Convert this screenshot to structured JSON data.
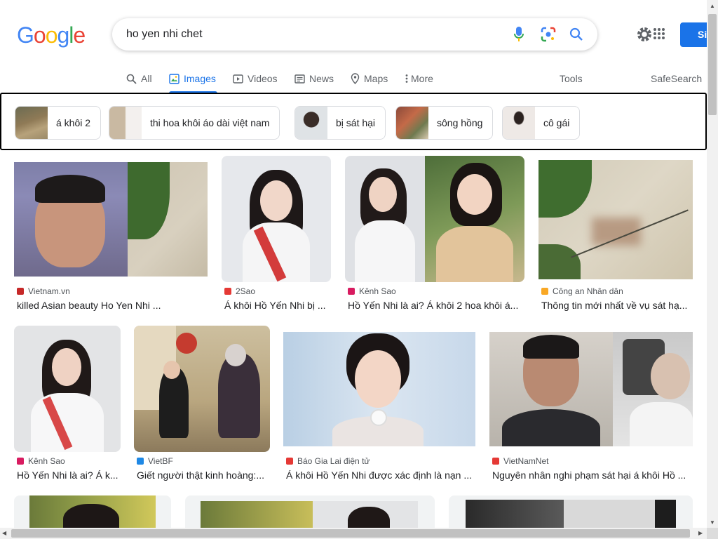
{
  "logo": {
    "letters": [
      "G",
      "o",
      "o",
      "g",
      "l",
      "e"
    ],
    "colors": [
      "#4285F4",
      "#EA4335",
      "#FBBC05",
      "#4285F4",
      "#34A853",
      "#EA4335"
    ]
  },
  "search": {
    "query": "ho yen nhi chet"
  },
  "icons": {
    "mic": "mic-icon",
    "lens": "lens-icon",
    "search": "search-icon",
    "settings": "gear-icon",
    "apps": "apps-grid-icon"
  },
  "header": {
    "signin_label": "Si"
  },
  "tabs": [
    {
      "label": "All",
      "icon": "search-icon"
    },
    {
      "label": "Images",
      "icon": "image-icon"
    },
    {
      "label": "Videos",
      "icon": "video-icon"
    },
    {
      "label": "News",
      "icon": "news-icon"
    },
    {
      "label": "Maps",
      "icon": "map-pin-icon"
    },
    {
      "label": "More",
      "icon": "more-icon"
    }
  ],
  "tools_label": "Tools",
  "safesearch_label": "SafeSearch",
  "chips": [
    {
      "label": "á khôi 2"
    },
    {
      "label": "thi hoa khôi áo dài việt nam"
    },
    {
      "label": "bị sát hại"
    },
    {
      "label": "sông hồng"
    },
    {
      "label": "cô gái"
    }
  ],
  "results": [
    {
      "source": "Vietnam.vn",
      "title": "killed Asian beauty Ho Yen Nhi ...",
      "fav_color": "#c62828"
    },
    {
      "source": "2Sao",
      "title": "Á khôi Hồ Yến Nhi bị ...",
      "fav_color": "#e53935"
    },
    {
      "source": "Kênh Sao",
      "title": "Hồ Yến Nhi là ai? Á khôi 2 hoa khôi á...",
      "fav_color": "#d81b60"
    },
    {
      "source": "Công an Nhân dân",
      "title": "Thông tin mới nhất về vụ sát hạ...",
      "fav_color": "#f9a825"
    },
    {
      "source": "Kênh Sao",
      "title": "Hồ Yến Nhi là ai? Á k...",
      "fav_color": "#d81b60"
    },
    {
      "source": "VietBF",
      "title": "Giết người thật kinh hoàng:...",
      "fav_color": "#1e88e5"
    },
    {
      "source": "Báo Gia Lai điện tử",
      "title": "Á khôi Hồ Yến Nhi được xác định là nạn ...",
      "fav_color": "#e53935"
    },
    {
      "source": "VietNamNet",
      "title": "Nguyên nhân nghi phạm sát hại á khôi Hồ ...",
      "fav_color": "#e53935"
    }
  ]
}
